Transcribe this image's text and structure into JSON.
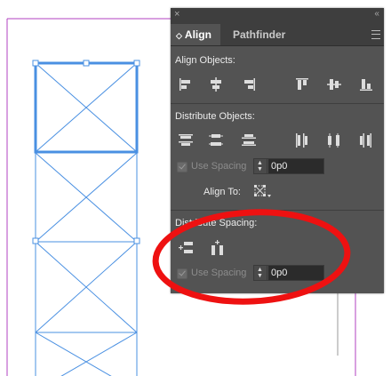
{
  "panel": {
    "tabs": [
      {
        "label": "Align"
      },
      {
        "label": "Pathfinder"
      }
    ],
    "close_glyph": "×",
    "collapse_glyph": "‹‹",
    "tab_arrows_glyph": "◇",
    "sections": {
      "align_objects": {
        "label": "Align Objects:"
      },
      "distribute_objects": {
        "label": "Distribute Objects:",
        "use_spacing_label": "Use Spacing",
        "use_spacing_checked": true,
        "use_spacing_enabled": false,
        "spacing_value": "0p0"
      },
      "align_to": {
        "label": "Align To:"
      },
      "distribute_spacing": {
        "label": "Distribute Spacing:",
        "use_spacing_label": "Use Spacing",
        "use_spacing_checked": true,
        "use_spacing_enabled": false,
        "spacing_value": "0p0"
      }
    }
  },
  "colors": {
    "panel_bg": "#535353",
    "tab_bar_bg": "#3e3e3e",
    "selection_blue": "#4a90e2",
    "page_margin_magenta": "#b040c0",
    "annotation_red": "#ee1111"
  },
  "icons": {
    "align_objects": [
      "align-left-edges-icon",
      "align-horizontal-centers-icon",
      "align-right-edges-icon",
      "align-top-edges-icon",
      "align-vertical-centers-icon",
      "align-bottom-edges-icon"
    ],
    "distribute_objects": [
      "distribute-top-edges-icon",
      "distribute-vertical-centers-icon",
      "distribute-bottom-edges-icon",
      "distribute-left-edges-icon",
      "distribute-horizontal-centers-icon",
      "distribute-right-edges-icon"
    ],
    "distribute_spacing": [
      "distribute-vertical-space-icon",
      "distribute-horizontal-space-icon"
    ]
  }
}
